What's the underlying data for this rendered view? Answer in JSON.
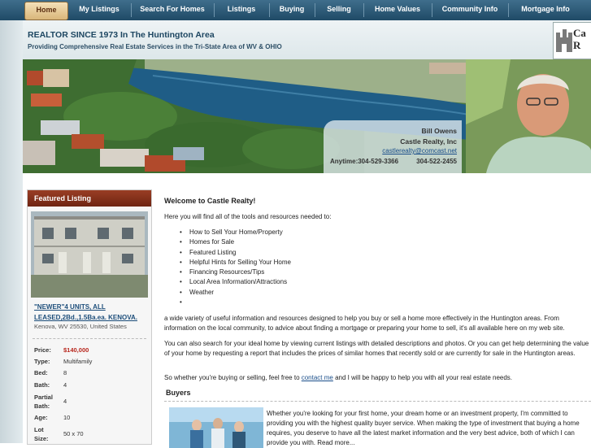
{
  "nav": {
    "items": [
      {
        "label": "Home",
        "active": true
      },
      {
        "label": "My Listings"
      },
      {
        "label": "Search For Homes"
      },
      {
        "label": "Listings"
      },
      {
        "label": "Buying"
      },
      {
        "label": "Selling"
      },
      {
        "label": "Home Values"
      },
      {
        "label": "Community Info"
      },
      {
        "label": "Mortgage Info"
      }
    ]
  },
  "header": {
    "title": "REALTOR SINCE 1973 In The Huntington Area",
    "subtitle": "Providing Comprehensive Real Estate Services in the Tri-State Area of WV & OHIO",
    "logo_text": "Castle Realty"
  },
  "agent": {
    "name": "Bill Owens",
    "company": "Castle Realty, Inc",
    "email": "castlerealty@comcast.net",
    "phone1": "Anytime:304-529-3366",
    "phone2": "304-522-2455"
  },
  "featured": {
    "heading": "Featured Listing",
    "title": "\"NEWER\"4 UNITS, ALL LEASED,2Bd.,1.5Ba.ea. KENOVA.",
    "location": "Kenova, WV 25530, United States",
    "specs": [
      {
        "key": "Price:",
        "value": "$140,000"
      },
      {
        "key": "Type:",
        "value": "Multifamily"
      },
      {
        "key": "Bed:",
        "value": "8"
      },
      {
        "key": "Bath:",
        "value": "4"
      },
      {
        "key": "Partial Bath:",
        "value": "4"
      },
      {
        "key": "Age:",
        "value": "10"
      },
      {
        "key": "Lot Size:",
        "value": "50 x 70"
      }
    ]
  },
  "main": {
    "welcome": "Welcome to Castle Realty!",
    "intro": "Here you will find all of the tools and resources needed to:",
    "tools": [
      "How to Sell  Your Home/Property",
      "Homes for Sale",
      "Featured Listing",
      "Helpful Hints for Selling Your Home",
      "Financing Resources/Tips",
      "Local Area Information/Attractions",
      "Weather",
      ""
    ],
    "para1": "a wide variety of useful information and resources designed to help you buy or sell a home more effectively in the Huntington areas. From information on the local community, to advice about finding a mortgage or preparing your home to sell, it's all available here on my web site.",
    "para2": "You can also search for your ideal home by viewing current listings with detailed descriptions and photos. Or you can get help determining the value of your home by requesting a report that includes the prices of similar homes that recently sold or are currently for sale in the Huntington areas.",
    "para3_before": "So whether you're buying or selling, feel free to ",
    "para3_link": "contact me",
    "para3_after": " and I will be happy to help you with all your real estate needs.",
    "buyers_heading": "Buyers",
    "buyers_text": "Whether you're looking for your first home, your dream home or an investment property, I'm committed to providing you with the highest quality buyer service. When making the type of investment that buying a home requires, you deserve to have all the latest market information and the very best advice, both of which I can provide you with. Read more..."
  }
}
